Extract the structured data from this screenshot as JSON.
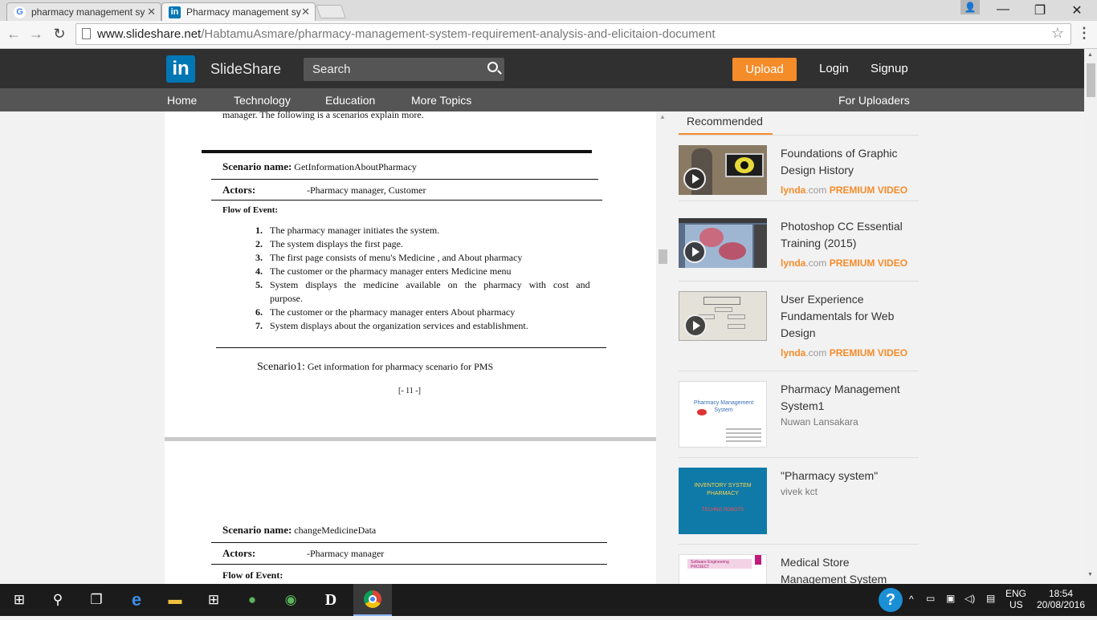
{
  "browser": {
    "tabs": [
      {
        "title": "pharmacy management sy",
        "favicon": "google-icon"
      },
      {
        "title": "Pharmacy management sy",
        "favicon": "linkedin-icon"
      }
    ],
    "url_domain": "www.slideshare.net",
    "url_path": "/HabtamuAsmare/pharmacy-management-system-requirement-analysis-and-elicitaion-document"
  },
  "header": {
    "logo": "in",
    "brand": "SlideShare",
    "search_placeholder": "Search",
    "upload": "Upload",
    "login": "Login",
    "signup": "Signup"
  },
  "nav": {
    "items": [
      "Home",
      "Technology",
      "Education",
      "More Topics"
    ],
    "for_uploaders": "For Uploaders"
  },
  "document": {
    "top_line": "manager. The following is a scenarios explain more.",
    "scenario1": {
      "label": "Scenario name:",
      "name": "GetInformationAboutPharmacy",
      "actors_label": "Actors:",
      "actors": "-Pharmacy manager, Customer",
      "flow_label": "Flow of Event:",
      "steps": [
        {
          "n": "1.",
          "text": "The pharmacy manager initiates the system."
        },
        {
          "n": "2.",
          "text": "The system displays the first page."
        },
        {
          "n": "3.",
          "text": "The first page consists of menu's Medicine , and About pharmacy"
        },
        {
          "n": "4.",
          "text": "The customer or the pharmacy manager enters Medicine menu"
        },
        {
          "n": "5.",
          "text": "System displays the medicine available on the pharmacy with cost and"
        },
        {
          "n": "",
          "text": "purpose."
        },
        {
          "n": "6.",
          "text": "The customer or the pharmacy manager enters About pharmacy"
        },
        {
          "n": "7.",
          "text": "System displays about the organization services and establishment."
        }
      ],
      "caption_label": "Scenario1:",
      "caption": "Get information for pharmacy scenario for PMS",
      "page_number": "[- 11 -]"
    },
    "scenario2": {
      "label": "Scenario name:",
      "name": "changeMedicineData",
      "actors_label": "Actors:",
      "actors": "-Pharmacy manager",
      "flow_label": "Flow of Event:"
    }
  },
  "sidebar": {
    "tab": "Recommended",
    "items": [
      {
        "title": "Foundations of Graphic Design History",
        "lynda": "lynda",
        "dotcom": ".com",
        "premium": "PREMIUM VIDEO"
      },
      {
        "title": "Photoshop CC Essential Training (2015)",
        "lynda": "lynda",
        "dotcom": ".com",
        "premium": "PREMIUM VIDEO"
      },
      {
        "title": "User Experience Fundamentals for Web Design",
        "lynda": "lynda",
        "dotcom": ".com",
        "premium": "PREMIUM VIDEO"
      },
      {
        "title": "Pharmacy Management System1",
        "author": "Nuwan Lansakara",
        "thumb_text": "Pharmacy Management System"
      },
      {
        "title": "\"Pharmacy system\"",
        "author": "vivek kct",
        "thumb_text": "INVENTORY SYSTEM PHARMACY",
        "thumb_sub": "TECHNO ROBOTS"
      },
      {
        "title": "Medical Store Management System Software",
        "thumb_text": "Software Engineering PROJECT"
      }
    ]
  },
  "taskbar": {
    "lang": "ENG",
    "region": "US",
    "time": "18:54",
    "date": "20/08/2016"
  },
  "colors": {
    "accent": "#f58c2a",
    "header_bg": "#303030",
    "nav_bg": "#555555",
    "linkedin_blue": "#0077b5"
  }
}
